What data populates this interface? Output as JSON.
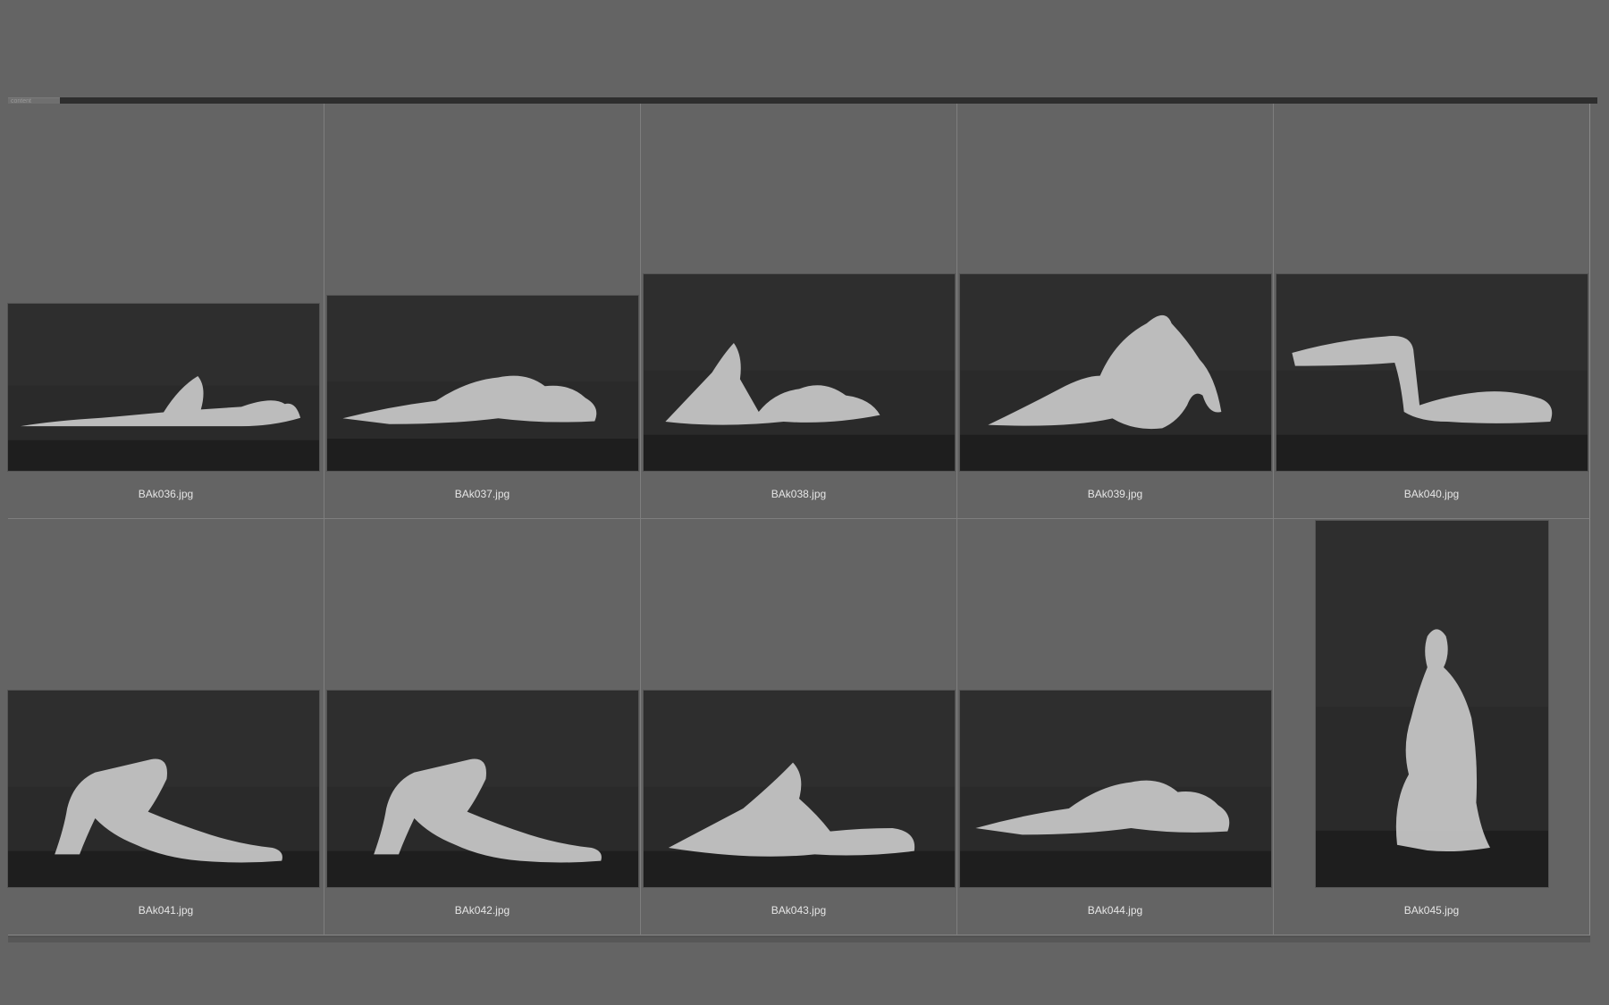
{
  "panel": {
    "tab_label": "content"
  },
  "thumbnails": [
    {
      "filename": "BAk036.jpg",
      "pose": "reclining"
    },
    {
      "filename": "BAk037.jpg",
      "pose": "side-lying"
    },
    {
      "filename": "BAk038.jpg",
      "pose": "reclining-knees-up"
    },
    {
      "filename": "BAk039.jpg",
      "pose": "seated-back"
    },
    {
      "filename": "BAk040.jpg",
      "pose": "legs-raised"
    },
    {
      "filename": "BAk041.jpg",
      "pose": "bridge"
    },
    {
      "filename": "BAk042.jpg",
      "pose": "bridge"
    },
    {
      "filename": "BAk043.jpg",
      "pose": "reclining-knee-up"
    },
    {
      "filename": "BAk044.jpg",
      "pose": "side-lying"
    },
    {
      "filename": "BAk045.jpg",
      "pose": "kneeling-portrait"
    }
  ],
  "colors": {
    "background": "#646464",
    "photo_backdrop": "#2a2a2a",
    "photo_floor": "#1e1e1e",
    "figure": "#c9c9c9",
    "caption": "#e6e6e6"
  }
}
